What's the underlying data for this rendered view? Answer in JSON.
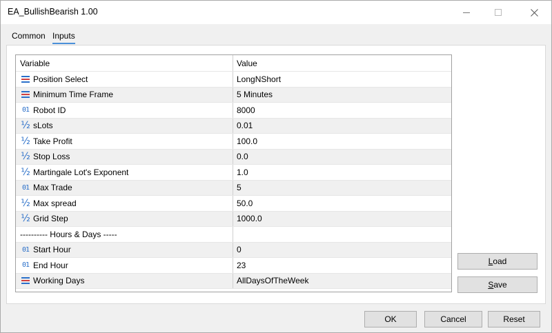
{
  "window": {
    "title": "EA_BullishBearish 1.00"
  },
  "tabs": [
    "Common",
    "Inputs"
  ],
  "table": {
    "headers": [
      "Variable",
      "Value"
    ],
    "rows": [
      {
        "variable": "Position Select",
        "value": "LongNShort",
        "icon": "enum-icon"
      },
      {
        "variable": "Minimum Time Frame",
        "value": "5 Minutes",
        "icon": "enum-icon"
      },
      {
        "variable": "Robot ID",
        "value": "8000",
        "icon": "integer-icon"
      },
      {
        "variable": "sLots",
        "value": "0.01",
        "icon": "double-icon"
      },
      {
        "variable": "Take Profit",
        "value": "100.0",
        "icon": "double-icon"
      },
      {
        "variable": "Stop Loss",
        "value": "0.0",
        "icon": "double-icon"
      },
      {
        "variable": "Martingale Lot's Exponent",
        "value": "1.0",
        "icon": "double-icon"
      },
      {
        "variable": "Max Trade",
        "value": "5",
        "icon": "integer-icon"
      },
      {
        "variable": "Max spread",
        "value": "50.0",
        "icon": "double-icon"
      },
      {
        "variable": "Grid Step",
        "value": "1000.0",
        "icon": "double-icon"
      },
      {
        "variable": "---------- Hours & Days -----",
        "value": "",
        "icon": ""
      },
      {
        "variable": "Start Hour",
        "value": "0",
        "icon": "integer-icon"
      },
      {
        "variable": "End Hour",
        "value": "23",
        "icon": "integer-icon"
      },
      {
        "variable": "Working Days",
        "value": "AllDaysOfTheWeek",
        "icon": "enum-icon"
      }
    ]
  },
  "buttons": {
    "load": {
      "underline": "L",
      "rest": "oad"
    },
    "save": {
      "underline": "S",
      "rest": "ave"
    },
    "ok": "OK",
    "cancel": "Cancel",
    "reset": "Reset"
  },
  "colors": {
    "accent": "#4a90d9",
    "icon_blue": "#2a6fc9"
  }
}
